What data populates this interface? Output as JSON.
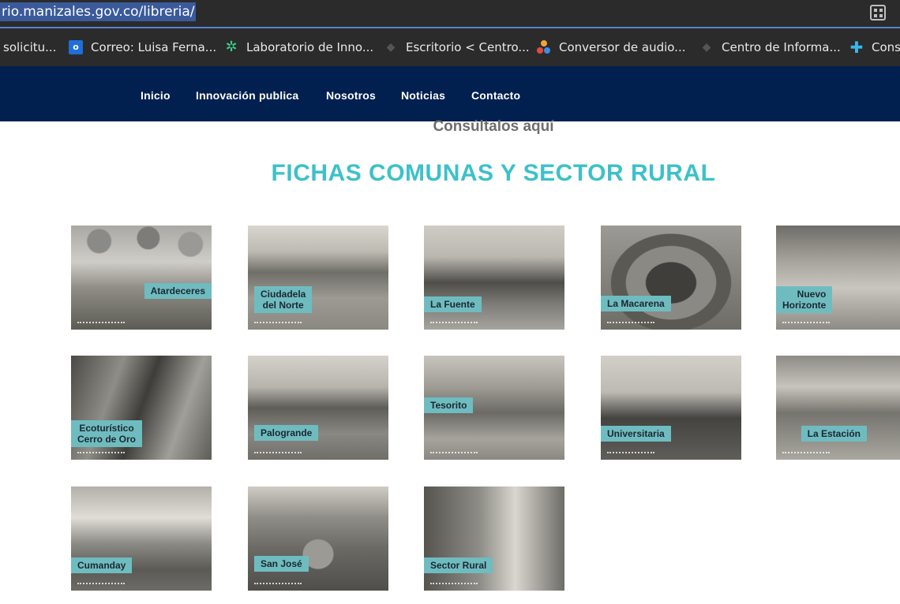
{
  "address_bar": {
    "url": "rio.manizales.gov.co/libreria/"
  },
  "bookmarks": [
    {
      "label": "solicitu...",
      "icon": "none"
    },
    {
      "label": "Correo: Luisa Ferna...",
      "icon": "outlook-icon"
    },
    {
      "label": "Laboratorio de Inno...",
      "icon": "lab-icon"
    },
    {
      "label": "Escritorio < Centro...",
      "icon": "generic-site-icon"
    },
    {
      "label": "Conversor de audio...",
      "icon": "dots-icon"
    },
    {
      "label": "Centro de Informa...",
      "icon": "generic-site-icon"
    },
    {
      "label": "Cons",
      "icon": "plus-icon"
    }
  ],
  "nav": {
    "items": [
      "Inicio",
      "Innovación publica",
      "Nosotros",
      "Noticias",
      "Contacto"
    ]
  },
  "content": {
    "subtitle": "Consúltalos aquí",
    "section_title": "FICHAS COMUNAS Y SECTOR RURAL"
  },
  "cards": [
    {
      "label": "Atardeceres"
    },
    {
      "label": "Ciudadela\ndel Norte"
    },
    {
      "label": "La Fuente"
    },
    {
      "label": "La Macarena"
    },
    {
      "label": "Nuevo\nHorizonte"
    },
    {
      "label": "Ecoturístico\nCerro de Oro"
    },
    {
      "label": "Palogrande"
    },
    {
      "label": "Tesorito"
    },
    {
      "label": "Universitaria"
    },
    {
      "label": "La Estación"
    },
    {
      "label": "Cumanday"
    },
    {
      "label": "San José"
    },
    {
      "label": "Sector Rural"
    }
  ],
  "colors": {
    "nav_bg": "#02204f",
    "title": "#3cc1c9",
    "label_bg": "#6fbcc0",
    "browser_bg": "#2b2b2b"
  }
}
